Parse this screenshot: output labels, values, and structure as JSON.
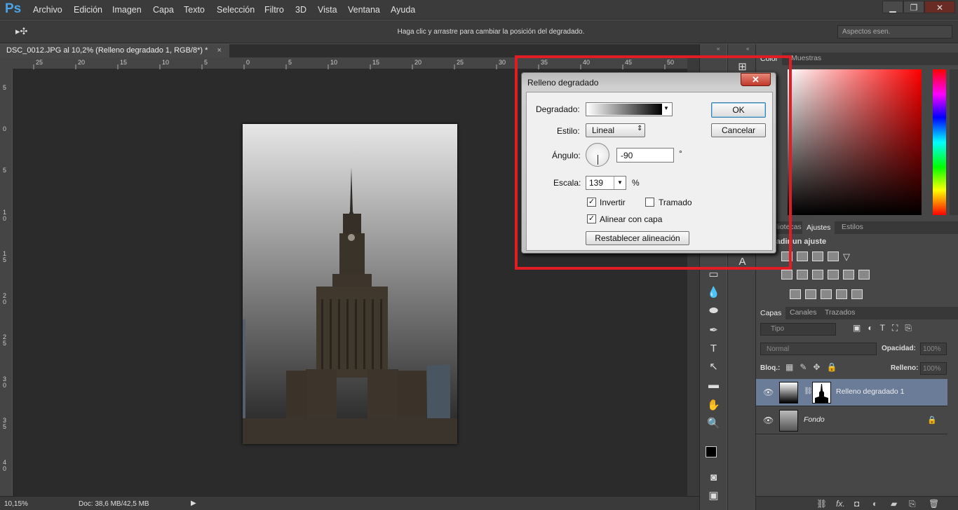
{
  "app": {
    "logo": "Ps"
  },
  "menu": [
    "Archivo",
    "Edición",
    "Imagen",
    "Capa",
    "Texto",
    "Selección",
    "Filtro",
    "3D",
    "Vista",
    "Ventana",
    "Ayuda"
  ],
  "window_controls": {
    "minimize": "▁",
    "restore": "❐",
    "close": "✕"
  },
  "options_bar": {
    "hint": "Haga clic y arrastre para cambiar la posición del degradado.",
    "workspace": "Aspectos esen."
  },
  "document": {
    "tab_title": "DSC_0012.JPG al 10,2% (Relleno degradado 1, RGB/8*) *",
    "tab_close": "×",
    "zoom": "10,15%",
    "doc_info": "Doc: 38,6 MB/42,5 MB"
  },
  "ruler": {
    "top_ticks": [
      "25",
      "20",
      "15",
      "10",
      "5",
      "0",
      "5",
      "10",
      "15",
      "20",
      "25",
      "30",
      "35",
      "40",
      "45",
      "50"
    ],
    "left_ticks": [
      "5",
      "0",
      "5",
      "1 0",
      "1 5",
      "2 0",
      "2 5",
      "3 0",
      "3 5",
      "4 0"
    ]
  },
  "dialog": {
    "title": "Relleno degradado",
    "close": "✕",
    "gradient_label": "Degradado:",
    "style_label": "Estilo:",
    "style_value": "Lineal",
    "angle_label": "Ángulo:",
    "angle_value": "-90",
    "angle_unit": "°",
    "scale_label": "Escala:",
    "scale_value": "139",
    "scale_unit": "%",
    "invert_label": "Invertir",
    "invert_checked": true,
    "dither_label": "Tramado",
    "dither_checked": false,
    "align_label": "Alinear con capa",
    "align_checked": true,
    "reset_label": "Restablecer alineación",
    "ok": "OK",
    "cancel": "Cancelar"
  },
  "panels": {
    "color_tabs": [
      "Color",
      "Muestras"
    ],
    "adjust_tabs": [
      "Bibliotecas",
      "Ajustes",
      "Estilos"
    ],
    "adjust_heading": "Añadir un ajuste",
    "layers_tabs": [
      "Capas",
      "Canales",
      "Trazados"
    ],
    "filter_placeholder": "Tipo",
    "blend_mode": "Normal",
    "opacity_label": "Opacidad:",
    "opacity_value": "100%",
    "lock_label": "Bloq.:",
    "fill_label": "Relleno:",
    "fill_value": "100%",
    "layers": [
      {
        "name": "Relleno degradado 1",
        "selected": true
      },
      {
        "name": "Fondo",
        "selected": false
      }
    ],
    "footer_fx": "fx."
  },
  "colors": {
    "highlight": "#e01c24",
    "accent": "#4aa4e8",
    "selected_layer": "#6b7c99"
  }
}
